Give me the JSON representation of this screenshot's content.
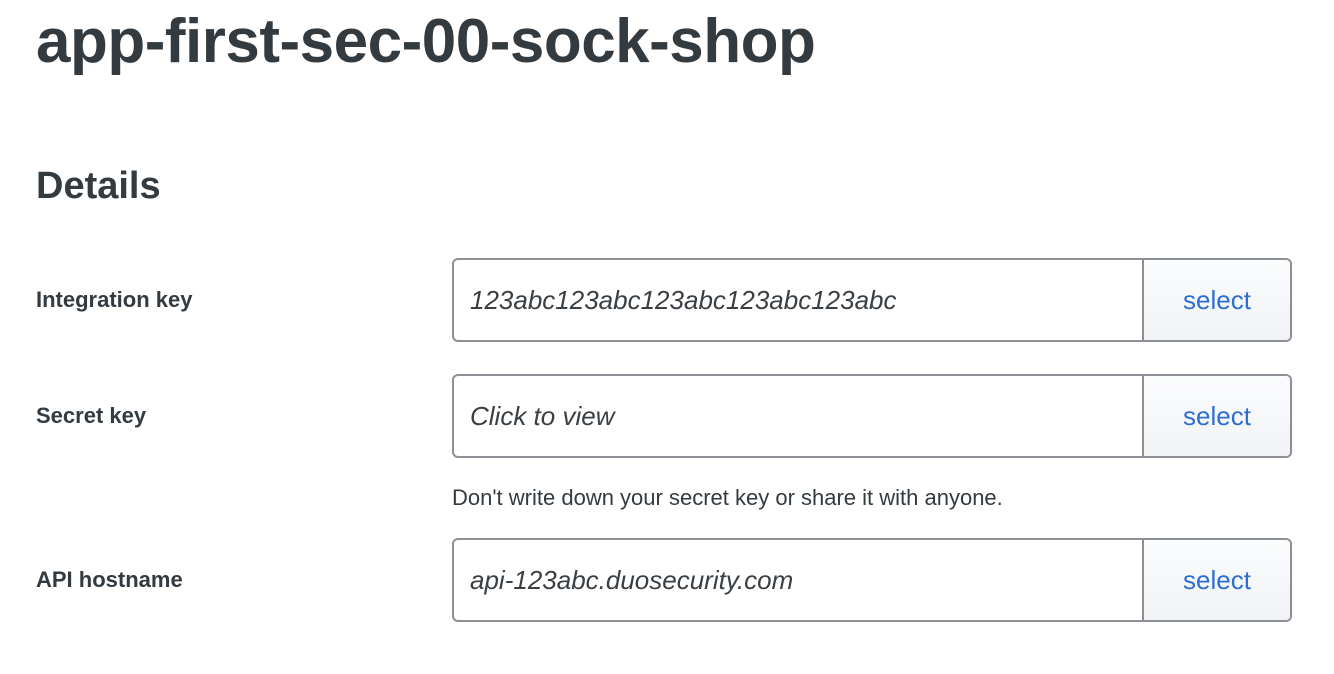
{
  "header": {
    "title": "app-first-sec-00-sock-shop"
  },
  "details": {
    "heading": "Details",
    "fields": [
      {
        "label": "Integration key",
        "value": "123abc123abc123abc123abc123abc",
        "button_label": "select"
      },
      {
        "label": "Secret key",
        "value": "Click to view",
        "button_label": "select",
        "help_text": "Don't write down your secret key or share it with anyone."
      },
      {
        "label": "API hostname",
        "value": "api-123abc.duosecurity.com",
        "button_label": "select"
      }
    ]
  },
  "colors": {
    "text": "#333b40",
    "link": "#2e6ed1",
    "border": "#8c9094",
    "button_bg": "#f4f6f8"
  }
}
